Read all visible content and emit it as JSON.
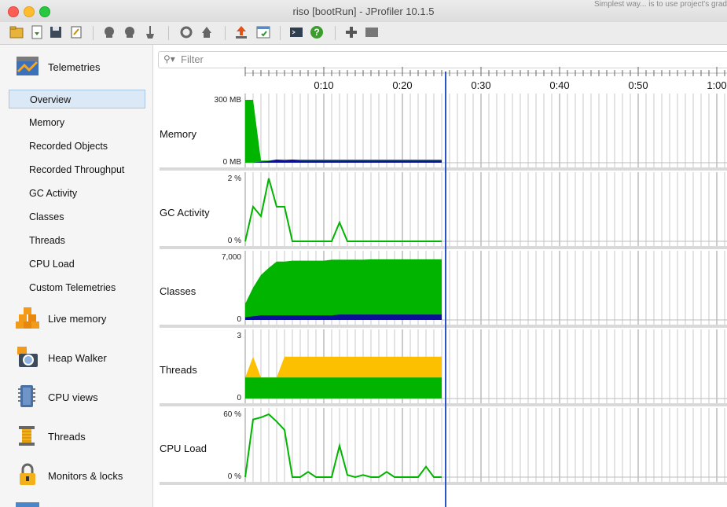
{
  "window": {
    "title": "riso [bootRun] - JProfiler 10.1.5",
    "background_peek": "Simplest way... is to use project's grad"
  },
  "toolbar": {
    "icons": [
      "open-session-icon",
      "import-icon",
      "save-icon",
      "edit-icon",
      "recording-icon",
      "recording-2-icon",
      "broom-icon",
      "refresh-icon",
      "snapshot-icon",
      "export-icon",
      "add-view-icon",
      "terminal-icon",
      "help-icon",
      "add-icon",
      "panel-icon"
    ]
  },
  "sidebar": {
    "telemetries": "Telemetries",
    "items": [
      {
        "label": "Overview",
        "selected": true
      },
      {
        "label": "Memory"
      },
      {
        "label": "Recorded Objects"
      },
      {
        "label": "Recorded Throughput"
      },
      {
        "label": "GC Activity"
      },
      {
        "label": "Classes"
      },
      {
        "label": "Threads"
      },
      {
        "label": "CPU Load"
      },
      {
        "label": "Custom Telemetries"
      }
    ],
    "sections": [
      {
        "label": "Live memory",
        "icon": "live-memory-icon"
      },
      {
        "label": "Heap Walker",
        "icon": "camera-icon"
      },
      {
        "label": "CPU views",
        "icon": "cpu-icon"
      },
      {
        "label": "Threads",
        "icon": "threads-spool-icon"
      },
      {
        "label": "Monitors & locks",
        "icon": "lock-icon"
      }
    ]
  },
  "filter": {
    "placeholder": "Filter"
  },
  "colors": {
    "green": "#00b400",
    "navy": "#0a0f96",
    "yellow": "#fcc000",
    "cursor": "#2a55c9",
    "grid": "#d0d0d0"
  },
  "chart_data": [
    {
      "type": "area",
      "title": "Memory",
      "ylim": [
        0,
        300
      ],
      "ytick_labels": [
        "300 MB",
        "0 MB"
      ],
      "x": [
        0,
        1,
        2,
        3,
        4,
        5,
        6,
        7,
        8,
        9,
        10,
        11,
        12,
        13,
        14,
        15,
        16,
        17,
        18,
        19,
        20,
        21,
        22,
        23,
        24,
        25
      ],
      "series": [
        {
          "values": [
            300,
            300,
            10,
            10,
            15,
            15,
            15,
            15,
            15,
            15,
            15,
            15,
            15,
            15,
            15,
            15,
            15,
            15,
            15,
            15,
            15,
            15,
            15,
            15,
            15,
            15
          ]
        },
        {
          "values": [
            0,
            0,
            5,
            8,
            15,
            10,
            15,
            10,
            10,
            10,
            10,
            10,
            10,
            10,
            10,
            10,
            10,
            10,
            10,
            10,
            10,
            10,
            10,
            10,
            10,
            10
          ]
        }
      ]
    },
    {
      "type": "line",
      "title": "GC Activity",
      "ylim": [
        0,
        2
      ],
      "ytick_labels": [
        "2 %",
        "0 %"
      ],
      "x": [
        0,
        1,
        2,
        3,
        4,
        5,
        6,
        7,
        8,
        9,
        10,
        11,
        12,
        13,
        14,
        15,
        16,
        17,
        18,
        19,
        20,
        21,
        22,
        23,
        24,
        25
      ],
      "series": [
        {
          "values": [
            0,
            1.1,
            0.8,
            2.0,
            1.1,
            1.1,
            0,
            0,
            0,
            0,
            0,
            0,
            0.6,
            0,
            0,
            0,
            0,
            0,
            0,
            0,
            0,
            0,
            0,
            0,
            0,
            0
          ]
        }
      ]
    },
    {
      "type": "area",
      "title": "Classes",
      "ylim": [
        0,
        7000
      ],
      "ytick_labels": [
        "7,000",
        "0"
      ],
      "x": [
        0,
        1,
        2,
        3,
        4,
        5,
        6,
        7,
        8,
        9,
        10,
        11,
        12,
        13,
        14,
        15,
        16,
        17,
        18,
        19,
        20,
        21,
        22,
        23,
        24,
        25
      ],
      "series": [
        {
          "values": [
            1800,
            3600,
            5000,
            5800,
            6500,
            6500,
            6600,
            6600,
            6600,
            6600,
            6600,
            6700,
            6700,
            6700,
            6700,
            6700,
            6750,
            6750,
            6750,
            6750,
            6750,
            6750,
            6750,
            6750,
            6750,
            6750
          ]
        },
        {
          "values": [
            300,
            400,
            500,
            500,
            500,
            500,
            500,
            500,
            500,
            500,
            500,
            500,
            600,
            600,
            600,
            600,
            600,
            600,
            600,
            600,
            600,
            600,
            600,
            600,
            600,
            600
          ]
        }
      ]
    },
    {
      "type": "area",
      "title": "Threads",
      "ylim": [
        0,
        3
      ],
      "ytick_labels": [
        "3",
        "0"
      ],
      "x": [
        0,
        1,
        2,
        3,
        4,
        5,
        6,
        7,
        8,
        9,
        10,
        11,
        12,
        13,
        14,
        15,
        16,
        17,
        18,
        19,
        20,
        21,
        22,
        23,
        24,
        25
      ],
      "series": [
        {
          "values": [
            1,
            2,
            1,
            1,
            1,
            2,
            2,
            2,
            2,
            2,
            2,
            2,
            2,
            2,
            2,
            2,
            2,
            2,
            2,
            2,
            2,
            2,
            2,
            2,
            2,
            2
          ]
        },
        {
          "values": [
            1,
            1,
            1,
            1,
            1,
            1,
            1,
            1,
            1,
            1,
            1,
            1,
            1,
            1,
            1,
            1,
            1,
            1,
            1,
            1,
            1,
            1,
            1,
            1,
            1,
            1
          ]
        }
      ]
    },
    {
      "type": "line",
      "title": "CPU Load",
      "ylim": [
        0,
        60
      ],
      "ytick_labels": [
        "60 %",
        "0 %"
      ],
      "x": [
        0,
        1,
        2,
        3,
        4,
        5,
        6,
        7,
        8,
        9,
        10,
        11,
        12,
        13,
        14,
        15,
        16,
        17,
        18,
        19,
        20,
        21,
        22,
        23,
        24,
        25
      ],
      "series": [
        {
          "values": [
            0,
            55,
            57,
            60,
            53,
            45,
            0,
            0,
            5,
            0,
            0,
            0,
            30,
            2,
            0,
            2,
            0,
            0,
            5,
            0,
            0,
            0,
            0,
            10,
            0,
            0
          ]
        }
      ]
    }
  ],
  "time_axis": {
    "labels": [
      "0:10",
      "0:20",
      "0:30",
      "0:40",
      "0:50",
      "1:00"
    ],
    "data_end_s": 25,
    "cursor_s": 25.5
  }
}
